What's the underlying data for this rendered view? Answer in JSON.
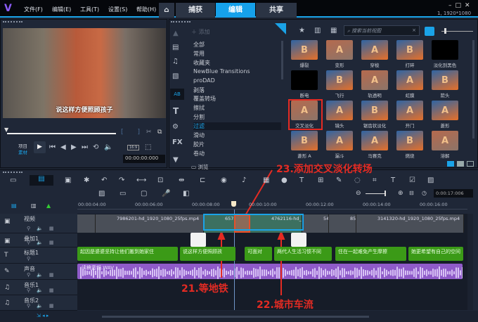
{
  "menu": {
    "items": [
      "文件(F)",
      "编辑(E)",
      "工具(T)",
      "设置(S)",
      "帮助(H)"
    ],
    "resolution": "1, 1920*1080"
  },
  "tabs": [
    {
      "label": "捕获"
    },
    {
      "label": "编辑",
      "active": true
    },
    {
      "label": "共享"
    }
  ],
  "preview": {
    "subtitle": "说这样方便照顾孩子",
    "mode_project": "项目",
    "mode_clip": "素材",
    "timecode": "00:00:00:000",
    "aspect": "16:9"
  },
  "library": {
    "add_label": "添加",
    "browse_label": "浏览",
    "search_placeholder": "搜索当前视图",
    "categories": [
      "全部",
      "常用",
      "收藏夹",
      "NewBlue Transitions",
      "proDAD",
      "剥落",
      "覆盖转场",
      "擦拭",
      "分割",
      "过滤",
      "滑动",
      "胶片",
      "卷动"
    ],
    "selected_category": "过滤",
    "effects": [
      "爆裂",
      "变形",
      "穿梭",
      "打碎",
      "淡化到黑色",
      "断电",
      "飞行",
      "轨透明",
      "虹膜",
      "箭头",
      "交叉淡化",
      "镜头",
      "锯齿状淡化",
      "开门",
      "菱形",
      "菱形 A",
      "漏斗",
      "马赛克",
      "燃烧",
      "溶解"
    ],
    "selected_effect": "交叉淡化"
  },
  "timeline": {
    "zoom_timecode": "0:00:17:006",
    "ruler": [
      "00:00:04:00",
      "00:00:06:00",
      "00:00:08:00",
      "00:00:10:00",
      "00:00:12:00",
      "00:00:14:00",
      "00:00:16:00"
    ],
    "tracks": [
      "视频",
      "叠加1",
      "标题1",
      "声音",
      "音乐1",
      "音乐2"
    ],
    "video_clips": [
      "",
      "7986201-hd_1920_1080_25fps.mp4",
      "6574",
      "",
      "4762116-hd_1",
      "547",
      "855",
      "3141320-hd_1920_1080_25fps.mp4"
    ],
    "title_clips": [
      "起因是婆婆坚持让他们搬到她家住",
      "说这样方便照顾孩",
      "可面对",
      "两代人生活习惯不同",
      "住在一起难免产生摩擦",
      "她更希望有自己的空间"
    ],
    "audio_clip": "读稿音频.WAV"
  },
  "annotations": [
    "21.等地铁",
    "22.城市车流",
    "23.添加交叉淡化转场"
  ],
  "colors": {
    "accent": "#16a1ea",
    "annotation": "#e42b23",
    "title_clip": "#3b9a17",
    "audio_clip": "#8f5bc9",
    "selected": "#1aa3e8"
  }
}
